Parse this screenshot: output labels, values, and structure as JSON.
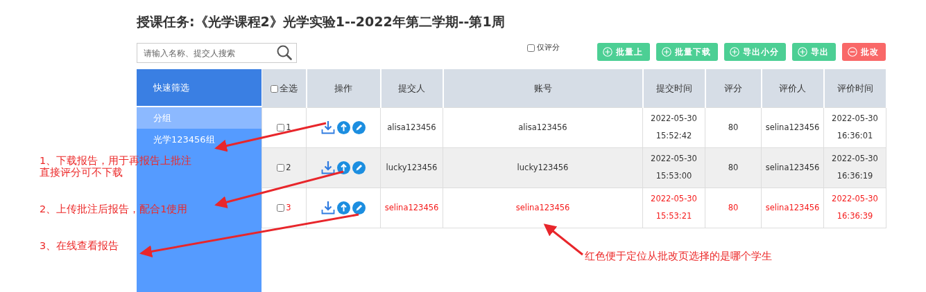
{
  "title": "授课任务:《光学课程2》光学实验1--2022年第二学期--第1周",
  "search": {
    "placeholder": "请输入名称、提交人搜索"
  },
  "only_scored": {
    "label": "仅评分",
    "checked": false
  },
  "buttons": [
    {
      "label": "批量上",
      "kind": "add"
    },
    {
      "label": "批量下载",
      "kind": "add"
    },
    {
      "label": "导出小分",
      "kind": "add"
    },
    {
      "label": "导出",
      "kind": "add"
    },
    {
      "label": "批改",
      "kind": "remove"
    }
  ],
  "sidebar": {
    "title": "快速筛选",
    "items": [
      {
        "label": "分组",
        "kind": "group"
      },
      {
        "label": "光学123456组",
        "kind": "item"
      }
    ]
  },
  "table": {
    "select_all": {
      "label": "全选",
      "checked": false
    },
    "columns": [
      "操作",
      "提交人",
      "账号",
      "提交时间",
      "评分",
      "评价人",
      "评价时间"
    ],
    "rows": [
      {
        "index": "1",
        "checked": false,
        "highlighted": false,
        "submitter": "alisa123456",
        "account": "alisa123456",
        "submit_time": "2022-05-30 15:52:42",
        "score": "80",
        "reviewer": "selina123456",
        "review_time": "2022-05-30 16:36:01"
      },
      {
        "index": "2",
        "checked": false,
        "highlighted": false,
        "submitter": "lucky123456",
        "account": "lucky123456",
        "submit_time": "2022-05-30 15:53:00",
        "score": "80",
        "reviewer": "selina123456",
        "review_time": "2022-05-30 16:36:19"
      },
      {
        "index": "3",
        "checked": false,
        "highlighted": true,
        "submitter": "selina123456",
        "account": "selina123456",
        "submit_time": "2022-05-30 15:53:21",
        "score": "80",
        "reviewer": "selina123456",
        "review_time": "2022-05-30 16:36:39"
      }
    ]
  },
  "annotations": [
    {
      "lines": [
        "1、下载报告，用于再报告上批注",
        "直接评分可不下载"
      ]
    },
    {
      "lines": [
        "2、上传批注后报告，配合1使用"
      ]
    },
    {
      "lines": [
        "3、在线查看报告"
      ]
    },
    {
      "lines": [
        "红色便于定位从批改页选择的是哪个学生"
      ]
    }
  ]
}
